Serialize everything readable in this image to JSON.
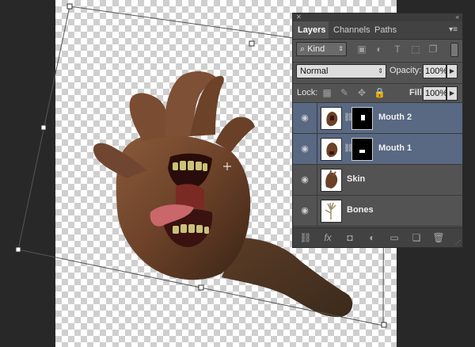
{
  "panel": {
    "tabs": [
      "Layers",
      "Channels",
      "Paths"
    ],
    "filter": {
      "kind_label": "Kind"
    },
    "blend_mode": "Normal",
    "opacity_label": "Opacity:",
    "opacity_value": "100%",
    "lock_label": "Lock:",
    "fill_label": "Fill:",
    "fill_value": "100%",
    "layers": [
      {
        "name": "Mouth 2",
        "selected": true,
        "has_mask": true
      },
      {
        "name": "Mouth 1",
        "selected": true,
        "has_mask": true
      },
      {
        "name": "Skin",
        "selected": false,
        "has_mask": false
      },
      {
        "name": "Bones",
        "selected": false,
        "has_mask": false
      }
    ]
  },
  "icons": {
    "visibility": "eye-icon",
    "link": "chain-link-icon",
    "search": "search-icon",
    "panel_menu": "menu-icon"
  },
  "colors": {
    "workspace": "#282828",
    "panel_bg": "#535353",
    "selected_layer": "#596883",
    "skin": "#6b4128"
  }
}
